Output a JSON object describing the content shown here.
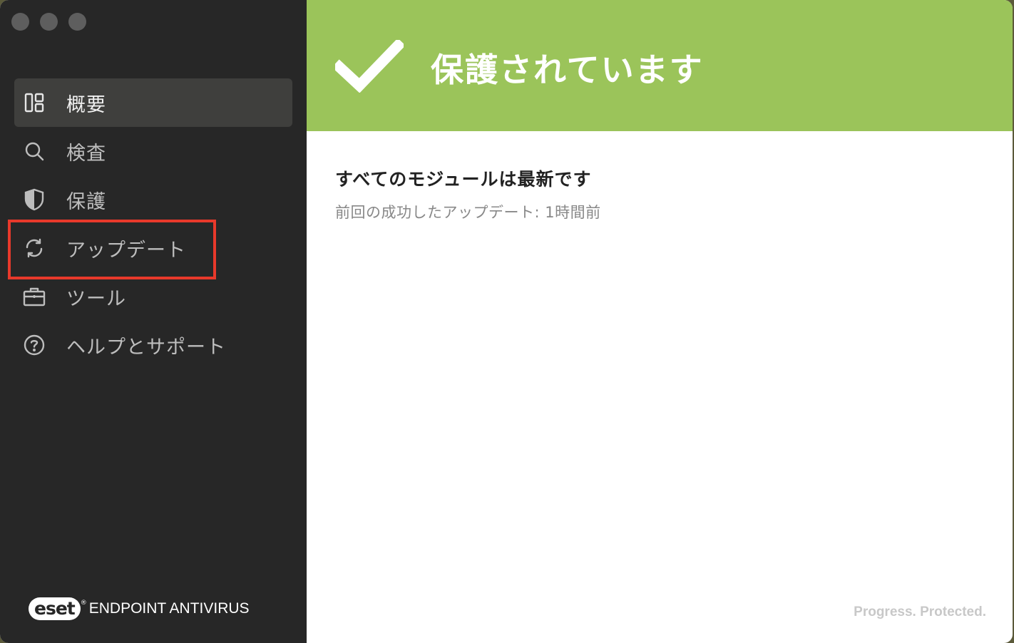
{
  "sidebar": {
    "items": [
      {
        "label": "概要",
        "icon": "dashboard-icon",
        "active": true
      },
      {
        "label": "検査",
        "icon": "search-icon",
        "active": false
      },
      {
        "label": "保護",
        "icon": "shield-icon",
        "active": false
      },
      {
        "label": "アップデート",
        "icon": "refresh-icon",
        "active": false
      },
      {
        "label": "ツール",
        "icon": "briefcase-icon",
        "active": false
      },
      {
        "label": "ヘルプとサポート",
        "icon": "help-icon",
        "active": false
      }
    ],
    "brand": {
      "logo": "eset",
      "product": "ENDPOINT ANTIVIRUS"
    }
  },
  "banner": {
    "title": "保護されています",
    "color": "#9bc45a"
  },
  "main": {
    "heading": "すべてのモジュールは最新です",
    "subtext": "前回の成功したアップデート:  1時間前"
  },
  "footer": {
    "tagline": "Progress. Protected."
  },
  "colors": {
    "sidebar_bg": "#272727",
    "accent_green": "#9bc45a",
    "highlight": "#e8392b"
  }
}
